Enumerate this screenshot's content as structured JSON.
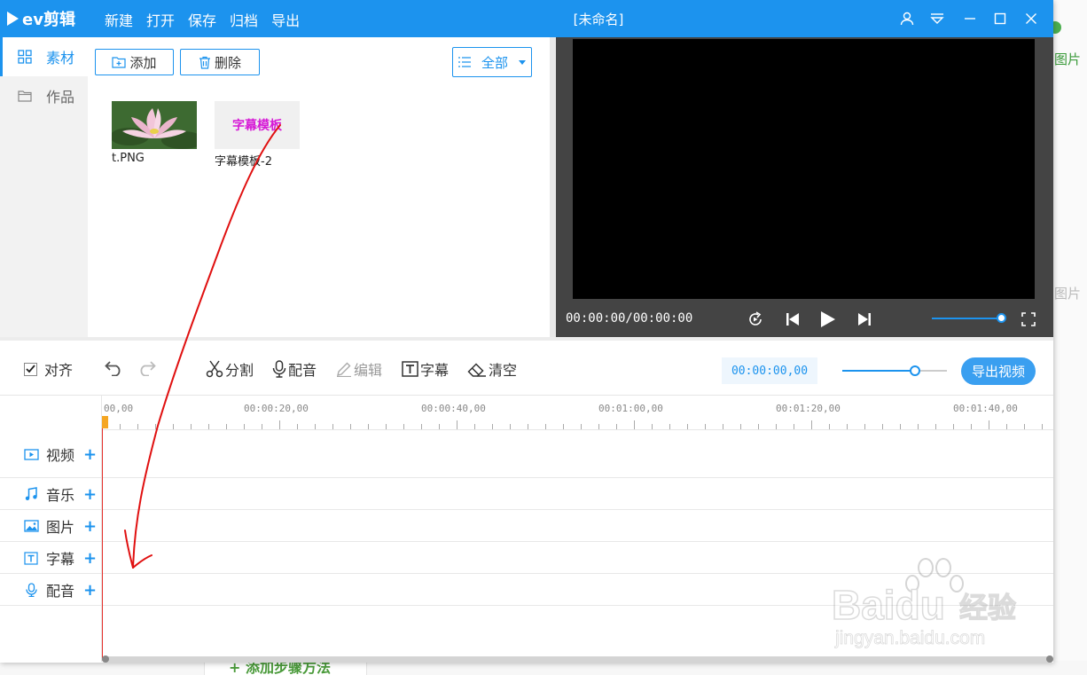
{
  "app": {
    "logo_text": "ev剪辑",
    "window_title": "[未命名]",
    "menu": [
      "新建",
      "打开",
      "保存",
      "归档",
      "导出"
    ]
  },
  "sidebar": {
    "items": [
      {
        "label": "素材",
        "icon": "grid-icon",
        "active": true
      },
      {
        "label": "作品",
        "icon": "folder-icon",
        "active": false
      }
    ]
  },
  "materials": {
    "add_label": "添加",
    "delete_label": "删除",
    "filter_label": "全部",
    "items": [
      {
        "caption": "t.PNG",
        "kind": "image"
      },
      {
        "caption": "字幕模板-2",
        "kind": "subtitle-template",
        "thumb_text": "字幕模板"
      }
    ]
  },
  "preview": {
    "time": "00:00:00/00:00:00",
    "volume": 0.9
  },
  "toolbar": {
    "align_label": "对齐",
    "align_checked": true,
    "split_label": "分割",
    "dub_label": "配音",
    "edit_label": "编辑",
    "subtitle_label": "字幕",
    "clear_label": "清空",
    "current_time": "00:00:00,00",
    "zoom": 0.7,
    "export_label": "导出视频"
  },
  "timeline": {
    "ruler_labels": [
      "00,00",
      "00:00:20,00",
      "00:00:40,00",
      "00:01:00,00",
      "00:01:20,00",
      "00:01:40,00"
    ],
    "tracks": [
      {
        "label": "视频",
        "icon": "video-icon"
      },
      {
        "label": "音乐",
        "icon": "music-icon"
      },
      {
        "label": "图片",
        "icon": "image-icon"
      },
      {
        "label": "字幕",
        "icon": "text-icon"
      },
      {
        "label": "配音",
        "icon": "microphone-icon"
      }
    ]
  },
  "background_page": {
    "label_top": "图片",
    "label_mid": "图片",
    "bottom_link": "+ 添加步骤方法"
  },
  "watermark": {
    "brand": "Bai",
    "brand2": "du",
    "cn": "经验",
    "url": "jingyan.baidu.com"
  },
  "colors": {
    "accent": "#1c93ee",
    "titlebar": "#1c93ee",
    "playhead": "#e5322d",
    "subtitle_thumb_text": "#d61ad6",
    "annotation": "#e01010"
  }
}
